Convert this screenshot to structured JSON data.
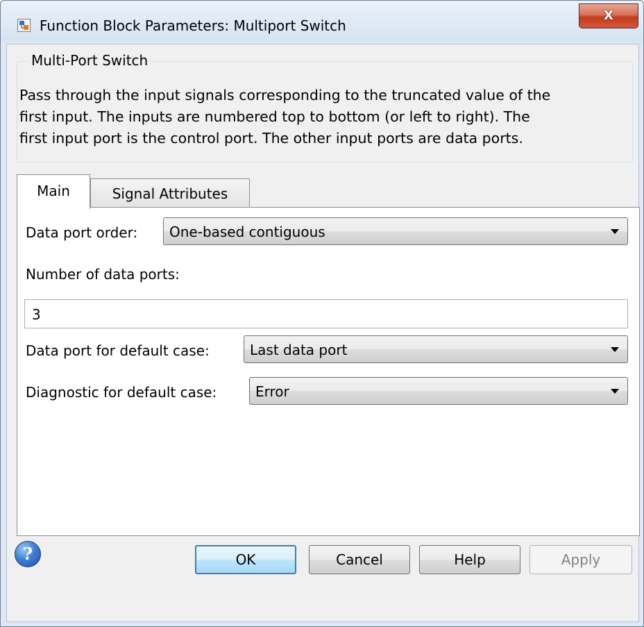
{
  "window": {
    "title": "Function Block Parameters: Multiport Switch",
    "close_glyph": "X"
  },
  "group": {
    "title": "Multi-Port Switch",
    "description_lines": [
      "Pass through the input signals corresponding to the truncated value of the",
      "first input. The inputs are numbered top to bottom (or left to right). The",
      "first input port is the control port. The other input ports are data ports."
    ]
  },
  "tabs": [
    {
      "label": "Main",
      "selected": true
    },
    {
      "label": "Signal Attributes",
      "selected": false
    }
  ],
  "main": {
    "data_port_order": {
      "label": "Data port order:",
      "value": "One-based contiguous"
    },
    "num_data_ports": {
      "label": "Number of data ports:",
      "value": "3"
    },
    "default_case_port": {
      "label": "Data port for default case:",
      "value": "Last data port"
    },
    "default_case_diagnostic": {
      "label": "Diagnostic for default case:",
      "value": "Error"
    }
  },
  "buttons": {
    "help_icon_glyph": "?",
    "ok": "OK",
    "cancel": "Cancel",
    "help": "Help",
    "apply": "Apply",
    "apply_enabled": false
  },
  "colors": {
    "ok_border": "#3c7fb1",
    "close_button": "#c43c1e",
    "disabled_text": "#838383"
  }
}
